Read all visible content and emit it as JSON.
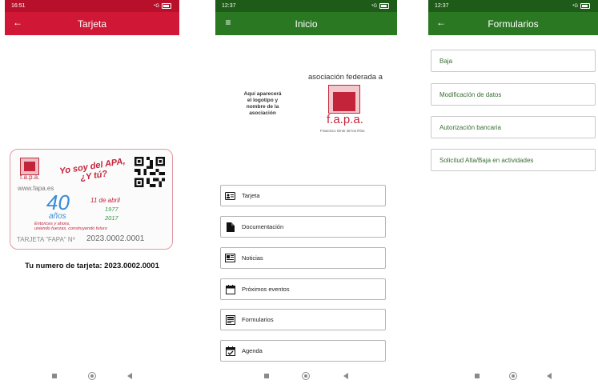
{
  "screen1": {
    "status": {
      "time": "16:51",
      "signal": "⁴G",
      "battery": "86"
    },
    "appbar": {
      "title": "Tarjeta",
      "nav_icon": "arrow-back-icon"
    },
    "card": {
      "org_name": "f.a.p.a.",
      "url": "www.fapa.es",
      "slogan_line1": "Yo soy del APA,",
      "slogan_line2": "¿Y tú?",
      "anniversary_number": "40",
      "anniversary_word": "años",
      "date": "11 de abril",
      "year_start": "1977",
      "year_end": "2017",
      "motto_line1": "Entonces y ahora,",
      "motto_line2": "uniendo fuerzas, construyendo futuro",
      "label": "TARJETA \"FAPA\" Nº",
      "number": "2023.0002.0001"
    },
    "card_number_text": "Tu numero de tarjeta: 2023.0002.0001"
  },
  "screen2": {
    "status": {
      "time": "12:37",
      "signal": "⁴G",
      "battery": "86"
    },
    "appbar": {
      "title": "Inicio",
      "nav_icon": "menu-icon"
    },
    "logo_placeholder": [
      "Aquí aparecerá",
      "el logotipo y",
      "nombre de la",
      "asociación"
    ],
    "federada_text": "asociación federada a",
    "fapa_logo_text": "f.a.p.a.",
    "fapa_logo_sub": "Francisco Giner de los Ríos",
    "menu": [
      {
        "label": "Tarjeta",
        "icon": "id-card-icon"
      },
      {
        "label": "Documentación",
        "icon": "document-icon"
      },
      {
        "label": "Noticias",
        "icon": "news-icon"
      },
      {
        "label": "Próximos eventos",
        "icon": "calendar-icon"
      },
      {
        "label": "Formularios",
        "icon": "form-icon"
      },
      {
        "label": "Agenda",
        "icon": "calendar-check-icon"
      }
    ]
  },
  "screen3": {
    "status": {
      "time": "12:37",
      "signal": "⁴G",
      "battery": "86"
    },
    "appbar": {
      "title": "Formularios",
      "nav_icon": "arrow-back-icon"
    },
    "forms": [
      {
        "label": "Baja"
      },
      {
        "label": "Modificación de datos"
      },
      {
        "label": "Autorización bancaria"
      },
      {
        "label": "Solicitud Alta/Baja en actividades"
      }
    ]
  }
}
